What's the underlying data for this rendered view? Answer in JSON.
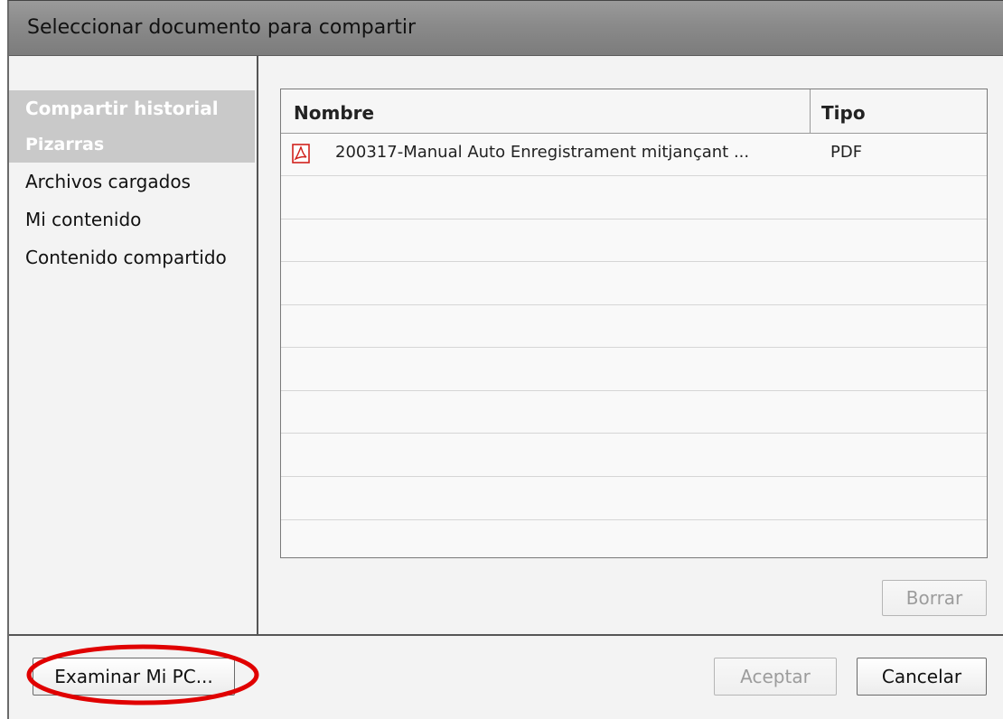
{
  "dialog": {
    "title": "Seleccionar documento para compartir"
  },
  "sidebar": {
    "items": [
      {
        "label": "Compartir historial"
      },
      {
        "label": "Pizarras"
      },
      {
        "label": "Archivos cargados"
      },
      {
        "label": "Mi contenido"
      },
      {
        "label": "Contenido compartido"
      }
    ]
  },
  "table": {
    "columns": {
      "name": "Nombre",
      "type": "Tipo"
    },
    "rows": [
      {
        "name": "200317-Manual Auto Enregistrament mitjançant ...",
        "type": "PDF",
        "icon": "pdf-icon"
      }
    ]
  },
  "buttons": {
    "delete": "Borrar",
    "browse": "Examinar Mi PC...",
    "accept": "Aceptar",
    "cancel": "Cancelar"
  },
  "colors": {
    "annotation": "#e00000",
    "pdf_red": "#d0211c"
  }
}
